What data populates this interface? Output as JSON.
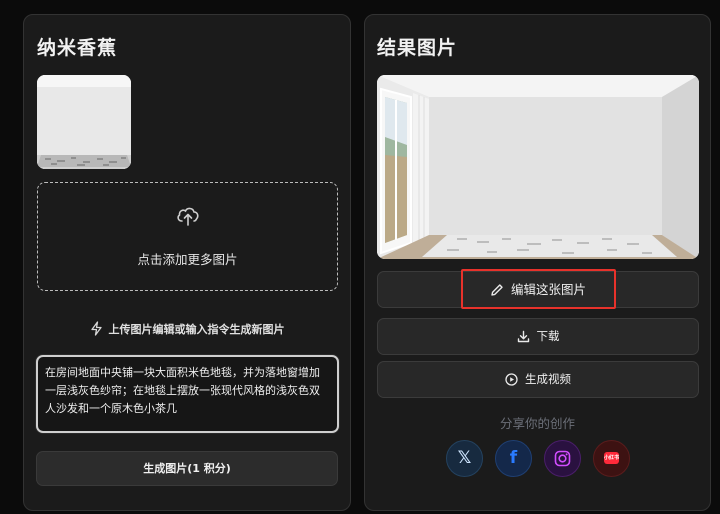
{
  "left_panel": {
    "title": "纳米香蕉",
    "upload_text": "点击添加更多图片",
    "hint": "上传图片编辑或输入指令生成新图片",
    "prompt_value": "在房间地面中央铺一块大面积米色地毯，并为落地窗增加一层浅灰色纱帘；在地毯上摆放一张现代风格的浅灰色双人沙发和一个原木色小茶几",
    "generate_label": "生成图片(1 积分)"
  },
  "right_panel": {
    "title": "结果图片",
    "edit_label": "编辑这张图片",
    "download_label": "下载",
    "video_label": "生成视频",
    "share_label": "分享你的创作",
    "social": {
      "x_glyph": "𝕏",
      "facebook_glyph": "f",
      "xiaohongshu_glyph": "小红书"
    }
  },
  "colors": {
    "highlight": "#e8322b",
    "panel_bg": "#1b1b1b"
  }
}
